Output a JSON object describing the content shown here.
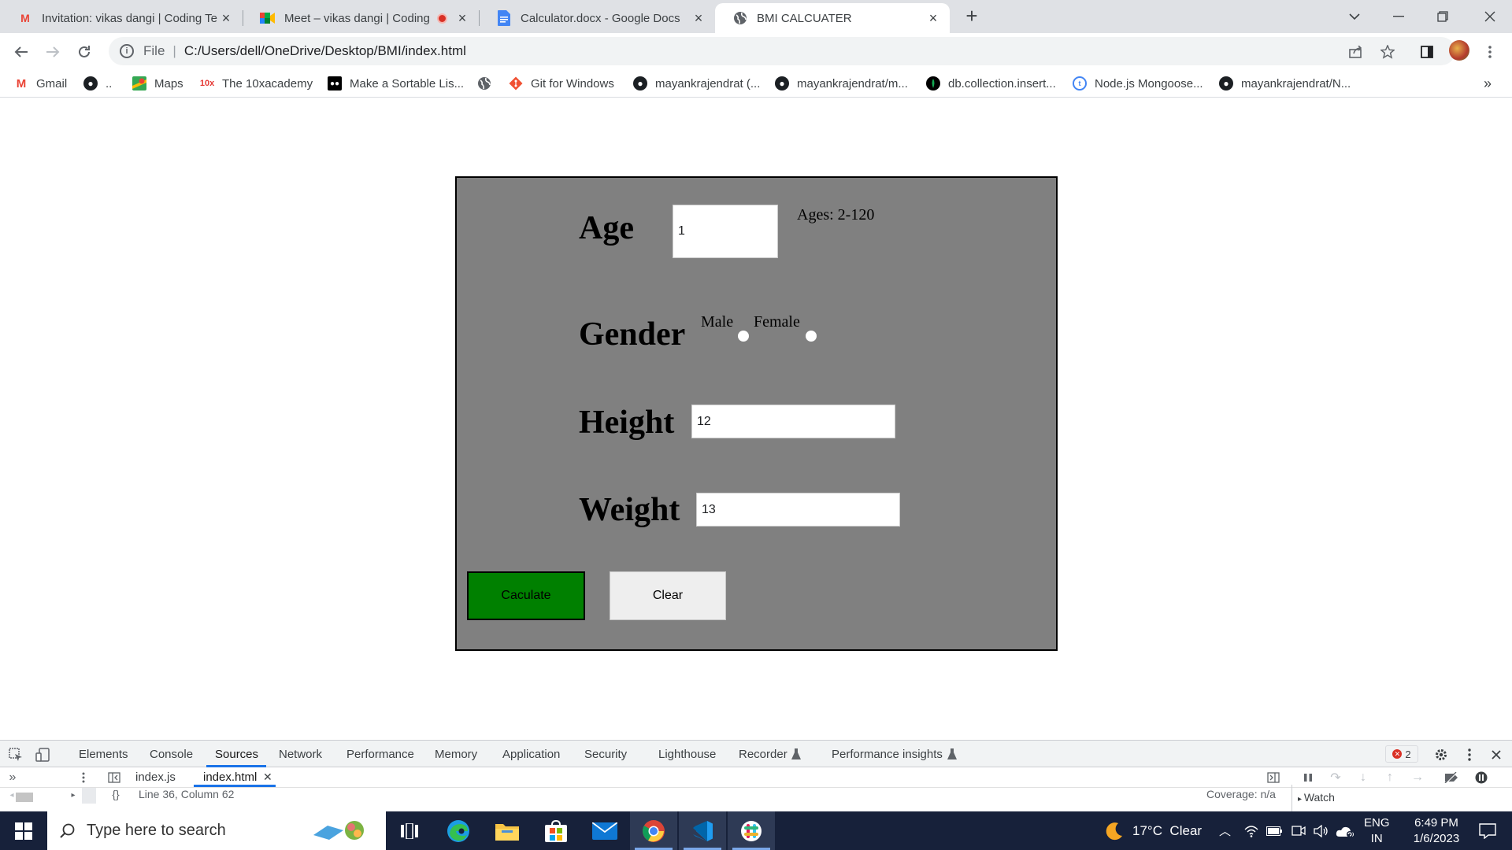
{
  "browser": {
    "tabs": [
      {
        "title": "Invitation: vikas dangi | Coding Te",
        "icon": "gmail-icon",
        "active": false
      },
      {
        "title": "Meet – vikas dangi | Coding T",
        "icon": "google-meet-icon",
        "active": false,
        "recording": true
      },
      {
        "title": "Calculator.docx - Google Docs",
        "icon": "google-docs-icon",
        "active": false
      },
      {
        "title": "BMI CALCUATER",
        "icon": "globe-icon",
        "active": true
      }
    ],
    "new_tab": "+",
    "close": "✕",
    "address": {
      "scheme": "File",
      "url": "C:/Users/dell/OneDrive/Desktop/BMI/index.html"
    },
    "bookmarks": [
      {
        "label": "Gmail",
        "icon": "gmail-icon"
      },
      {
        "label": "..",
        "icon": "github-icon"
      },
      {
        "label": "Maps",
        "icon": "maps-icon"
      },
      {
        "label": "The 10xacademy",
        "icon": "10x-icon"
      },
      {
        "label": "Make a Sortable Lis...",
        "icon": "medium-icon"
      },
      {
        "label": "",
        "icon": "globe-icon"
      },
      {
        "label": "Git for Windows",
        "icon": "git-icon"
      },
      {
        "label": "mayankrajendrat (...",
        "icon": "github-icon"
      },
      {
        "label": "mayankrajendrat/m...",
        "icon": "github-icon"
      },
      {
        "label": "db.collection.insert...",
        "icon": "mongodb-icon"
      },
      {
        "label": "Node.js Mongoose...",
        "icon": "nodejs-icon"
      },
      {
        "label": "mayankrajendrat/N...",
        "icon": "github-icon"
      }
    ],
    "more_bookmarks": "»"
  },
  "form": {
    "age_label": "Age",
    "age_value": "1",
    "age_hint": "Ages: 2-120",
    "gender_label": "Gender",
    "male_label": "Male",
    "female_label": "Female",
    "height_label": "Height",
    "height_value": "12",
    "weight_label": "Weight",
    "weight_value": "13",
    "calculate_button": "Caculate",
    "clear_button": "Clear",
    "box_color": "#808080",
    "calculate_color": "#008000",
    "clear_color": "#eeeeee"
  },
  "devtools": {
    "tabs": [
      "Elements",
      "Console",
      "Sources",
      "Network",
      "Performance",
      "Memory",
      "Application",
      "Security",
      "Lighthouse",
      "Recorder",
      "Performance insights"
    ],
    "active_tab": "Sources",
    "error_count": "2",
    "files": [
      "index.js",
      "index.html"
    ],
    "active_file": "index.html",
    "cursor_position": "Line 36, Column 62",
    "coverage": "Coverage: n/a",
    "watch": "Watch"
  },
  "taskbar": {
    "search_placeholder": "Type here to search",
    "weather": "17°C  Clear",
    "lang": "ENG",
    "region": "IN",
    "time": "6:49 PM",
    "date": "1/6/2023"
  }
}
